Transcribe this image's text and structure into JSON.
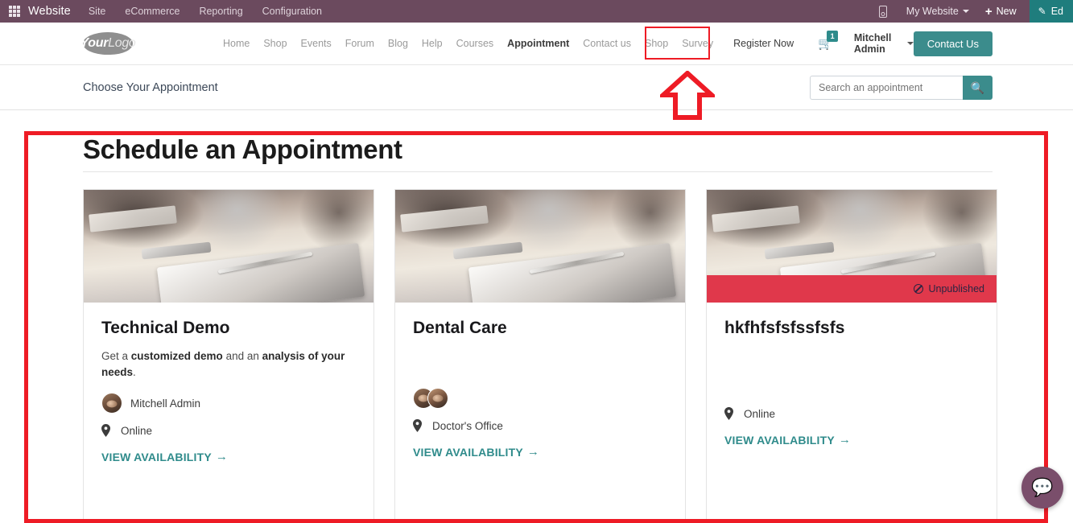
{
  "backend_bar": {
    "apps_icon": "apps-grid-icon",
    "app_name": "Website",
    "menus": [
      "Site",
      "eCommerce",
      "Reporting",
      "Configuration"
    ],
    "mobile_icon": "mobile-preview-icon",
    "website_selector": "My Website",
    "new_label": "New",
    "new_icon": "plus-icon",
    "edit_label": "Ed",
    "edit_icon": "pencil-icon",
    "bar_color": "#6b4a5e",
    "edit_color": "#1f7d7d"
  },
  "site_nav": {
    "logo_main": "Your",
    "logo_sub": "Logo",
    "links": [
      {
        "label": "Home",
        "active": false
      },
      {
        "label": "Shop",
        "active": false
      },
      {
        "label": "Events",
        "active": false
      },
      {
        "label": "Forum",
        "active": false
      },
      {
        "label": "Blog",
        "active": false
      },
      {
        "label": "Help",
        "active": false
      },
      {
        "label": "Courses",
        "active": false
      },
      {
        "label": "Appointment",
        "active": true
      },
      {
        "label": "Contact us",
        "active": false
      },
      {
        "label": "Shop",
        "active": false
      },
      {
        "label": "Survey",
        "active": false
      }
    ],
    "register_now": "Register Now",
    "cart_icon": "shopping-cart-icon",
    "cart_count": "1",
    "user_name": "Mitchell Admin",
    "contact_button": "Contact Us",
    "accent_color": "#3b8c8c"
  },
  "subheader": {
    "title": "Choose Your Appointment",
    "search_placeholder": "Search an appointment",
    "search_value": "",
    "search_icon": "magnifier-icon"
  },
  "main": {
    "page_title": "Schedule an Appointment",
    "cards": [
      {
        "title": "Technical Demo",
        "desc_pre": "Get a ",
        "desc_b1": "customized demo",
        "desc_mid": " and an ",
        "desc_b2": "analysis of your needs",
        "desc_post": ".",
        "staff": [
          "Mitchell Admin"
        ],
        "staff_count": 1,
        "location": "Online",
        "cta": "VIEW AVAILABILITY",
        "cta_arrow": "→",
        "published": true,
        "image_alt": "desk-notebook-pen-photo"
      },
      {
        "title": "Dental Care",
        "desc_pre": "",
        "desc_b1": "",
        "desc_mid": "",
        "desc_b2": "",
        "desc_post": "",
        "staff": [
          "",
          ""
        ],
        "staff_count": 2,
        "location": "Doctor's Office",
        "cta": "VIEW AVAILABILITY",
        "cta_arrow": "→",
        "published": true,
        "image_alt": "desk-notebook-pen-photo"
      },
      {
        "title": "hkfhfsfsfssfsfs",
        "desc_pre": "",
        "desc_b1": "",
        "desc_mid": "",
        "desc_b2": "",
        "desc_post": "",
        "staff": [],
        "staff_count": 0,
        "location": "Online",
        "cta": "VIEW AVAILABILITY",
        "cta_arrow": "→",
        "published": false,
        "unpublished_label": "Unpublished",
        "unpublished_icon": "blocked-circle-icon",
        "image_alt": "desk-notebook-pen-photo"
      }
    ]
  },
  "chat": {
    "icon": "chat-bubble-icon",
    "color": "#7a4e6b"
  },
  "annotations": {
    "highlight_color": "#ee1b25",
    "register_now_box": true,
    "arrow_points_to": "Register Now",
    "content_box": true
  }
}
